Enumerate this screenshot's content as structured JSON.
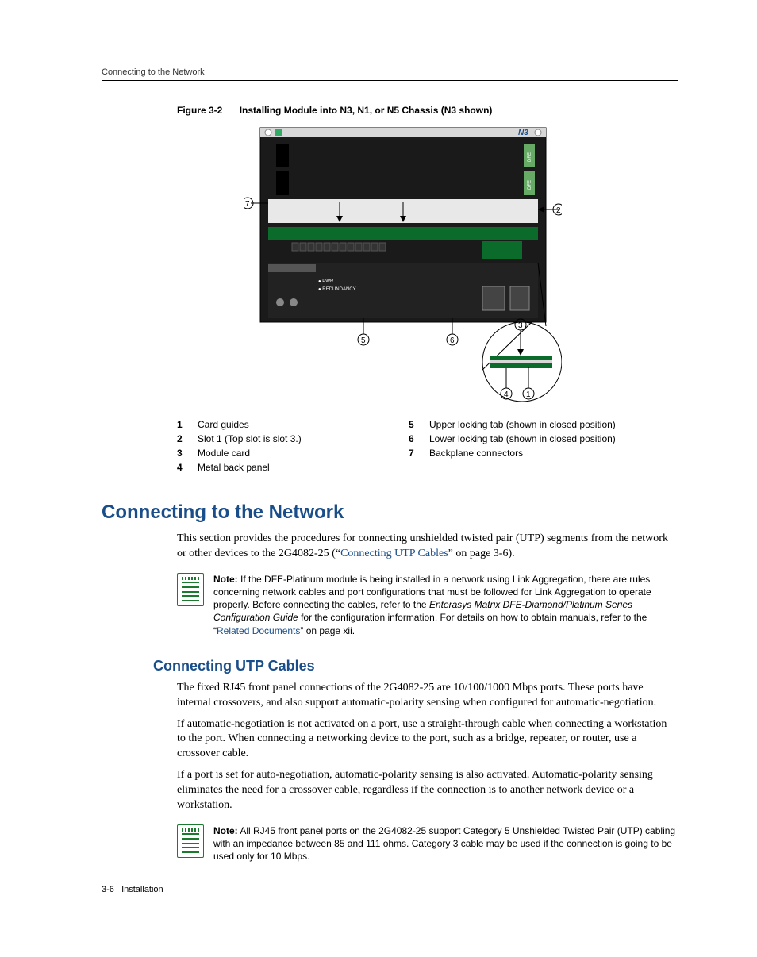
{
  "header": {
    "running_title": "Connecting to the Network"
  },
  "figure": {
    "label": "Figure 3-2",
    "title": "Installing Module into N3, N1, or N5 Chassis (N3 shown)",
    "chassis_label": "N3",
    "callouts": [
      "1",
      "2",
      "3",
      "4",
      "5",
      "6",
      "7"
    ],
    "legend": [
      {
        "num": "1",
        "text": "Card guides"
      },
      {
        "num": "2",
        "text": "Slot 1 (Top slot is slot 3.)"
      },
      {
        "num": "3",
        "text": "Module card"
      },
      {
        "num": "4",
        "text": "Metal back panel"
      },
      {
        "num": "5",
        "text": "Upper locking tab (shown in closed position)"
      },
      {
        "num": "6",
        "text": "Lower locking tab (shown in closed position)"
      },
      {
        "num": "7",
        "text": "Backplane connectors"
      }
    ]
  },
  "sections": {
    "main_heading": "Connecting to the Network",
    "intro_pre": "This section provides the procedures for connecting unshielded twisted pair (UTP) segments from the network or other devices to the 2G4082-25 (“",
    "intro_link": "Connecting UTP Cables",
    "intro_post": "” on page 3-6).",
    "note1": {
      "prefix": "Note:",
      "body_pre": " If the DFE-Platinum module is being installed in a network using Link Aggregation, there are rules concerning network cables and port configurations that must be followed for Link Aggregation to operate properly. Before connecting the cables, refer to the ",
      "ital": "Enterasys Matrix DFE-Diamond/Platinum Series Configuration Guide",
      "body_mid": " for the configuration information. For details on how to obtain manuals, refer to the “",
      "link": "Related Documents",
      "body_post": "”  on page xii."
    },
    "sub_heading": "Connecting UTP Cables",
    "p1": "The fixed RJ45 front panel connections of the 2G4082-25 are 10/100/1000 Mbps ports. These ports have internal crossovers, and also support automatic-polarity sensing when configured for automatic-negotiation.",
    "p2": "If automatic-negotiation is not activated on a port, use a straight-through cable when connecting a workstation to the port. When connecting a networking device to the port, such as a bridge, repeater, or router, use a crossover cable.",
    "p3": "If a port is set for auto-negotiation, automatic-polarity sensing is also activated. Automatic-polarity sensing eliminates the need for a crossover cable, regardless if the connection is to another network device or a workstation.",
    "note2": {
      "prefix": "Note:",
      "body": " All RJ45 front panel ports on the 2G4082-25 support Category 5 Unshielded Twisted Pair (UTP) cabling with an impedance between 85 and 111 ohms. Category 3 cable may be used if the connection is going to be used only for 10 Mbps."
    }
  },
  "footer": {
    "page": "3-6",
    "chapter": "Installation"
  }
}
